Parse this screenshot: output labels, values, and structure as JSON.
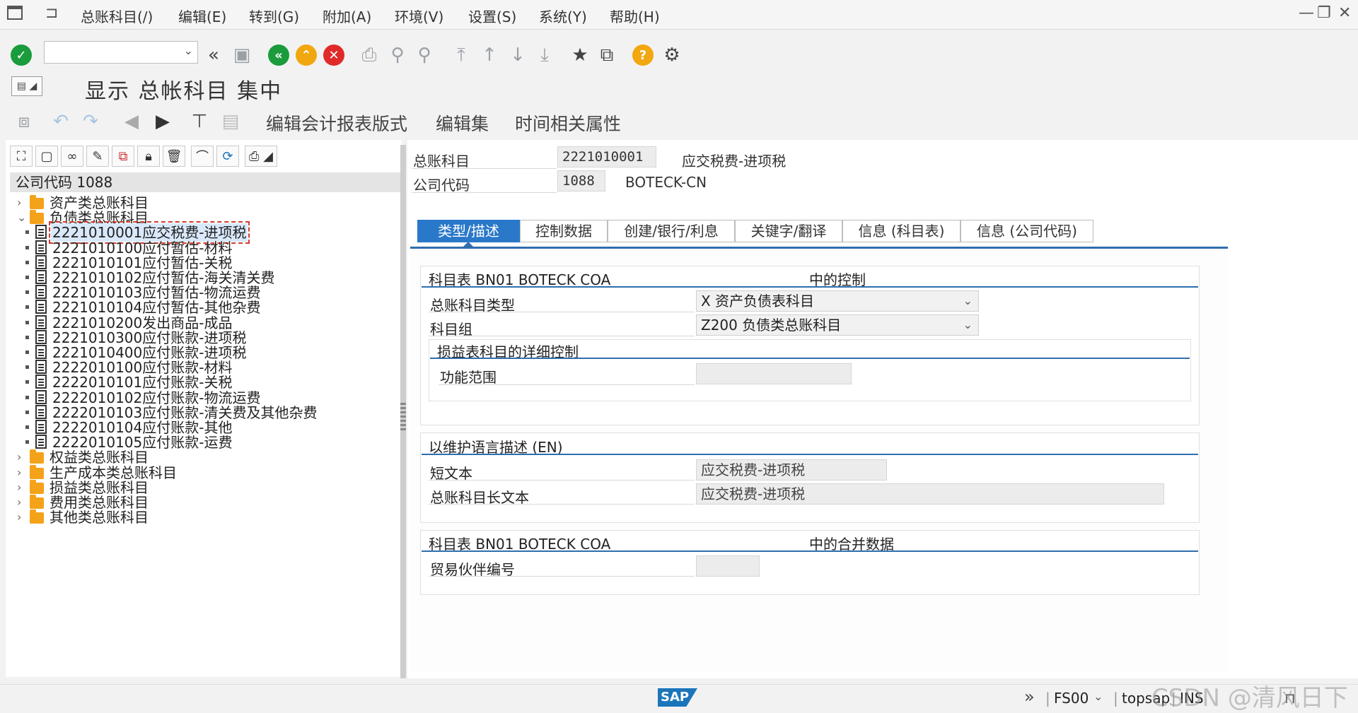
{
  "menu": {
    "items": [
      "总账科目(/)",
      "编辑(E)",
      "转到(G)",
      "附加(A)",
      "环境(V)",
      "设置(S)",
      "系统(Y)",
      "帮助(H)"
    ]
  },
  "toolbar": {
    "command_value": ""
  },
  "page": {
    "title": "显示 总帐科目 集中"
  },
  "app_toolbar": {
    "edit_report_layout": "编辑会计报表版式",
    "edit_set": "编辑集",
    "time_attributes": "时间相关属性"
  },
  "tree": {
    "header": "公司代码 1088",
    "folders_top": [
      "资产类总账科目",
      "负债类总账科目"
    ],
    "accounts": [
      {
        "code": "2221010001",
        "name": "应交税费-进项税",
        "selected": true
      },
      {
        "code": "2221010100",
        "name": "应付暂估-材料"
      },
      {
        "code": "2221010101",
        "name": "应付暂估-关税"
      },
      {
        "code": "2221010102",
        "name": "应付暂估-海关清关费"
      },
      {
        "code": "2221010103",
        "name": "应付暂估-物流运费"
      },
      {
        "code": "2221010104",
        "name": "应付暂估-其他杂费"
      },
      {
        "code": "2221010200",
        "name": "发出商品-成品"
      },
      {
        "code": "2221010300",
        "name": "应付账款-进项税"
      },
      {
        "code": "2221010400",
        "name": "应付账款-进项税"
      },
      {
        "code": "2222010100",
        "name": "应付账款-材料"
      },
      {
        "code": "2222010101",
        "name": "应付账款-关税"
      },
      {
        "code": "2222010102",
        "name": "应付账款-物流运费"
      },
      {
        "code": "2222010103",
        "name": "应付账款-清关费及其他杂费"
      },
      {
        "code": "2222010104",
        "name": "应付账款-其他"
      },
      {
        "code": "2222010105",
        "name": "应付账款-运费"
      }
    ],
    "folders_bottom": [
      "权益类总账科目",
      "生产成本类总账科目",
      "损益类总账科目",
      "费用类总账科目",
      "其他类总账科目"
    ]
  },
  "header": {
    "gl_account_label": "总账科目",
    "gl_account_value": "2221010001",
    "gl_account_desc": "应交税费-进项税",
    "company_code_label": "公司代码",
    "company_code_value": "1088",
    "company_code_desc": "BOTECK-CN"
  },
  "tabs": [
    "类型/描述",
    "控制数据",
    "创建/银行/利息",
    "关键字/翻译",
    "信息 (科目表)",
    "信息 (公司代码)"
  ],
  "control_group": {
    "title_left": "科目表 BN01 BOTECK COA",
    "title_right": "中的控制",
    "account_type_label": "总账科目类型",
    "account_type_value": "X 资产负债表科目",
    "account_group_label": "科目组",
    "account_group_value": "Z200 负债类总账科目",
    "pl_sub_title": "损益表科目的详细控制",
    "functional_area_label": "功能范围",
    "functional_area_value": ""
  },
  "description_group": {
    "title": "以维护语言描述 (EN)",
    "short_text_label": "短文本",
    "short_text_value": "应交税费-进项税",
    "long_text_label": "总账科目长文本",
    "long_text_value": "应交税费-进项税"
  },
  "consolidation_group": {
    "title_left": "科目表 BN01 BOTECK COA",
    "title_right": "中的合并数据",
    "trading_partner_label": "贸易伙伴编号",
    "trading_partner_value": ""
  },
  "status": {
    "transaction": "FS00",
    "system": "topsap",
    "mode": "INS",
    "logo_text": "SAP"
  },
  "watermark": "CSDN @清风日下",
  "colors": {
    "accent": "#2a78c9",
    "ok_green": "#1a9b3c",
    "cancel_red": "#e02a2a",
    "exit_orange": "#f1a70f"
  }
}
